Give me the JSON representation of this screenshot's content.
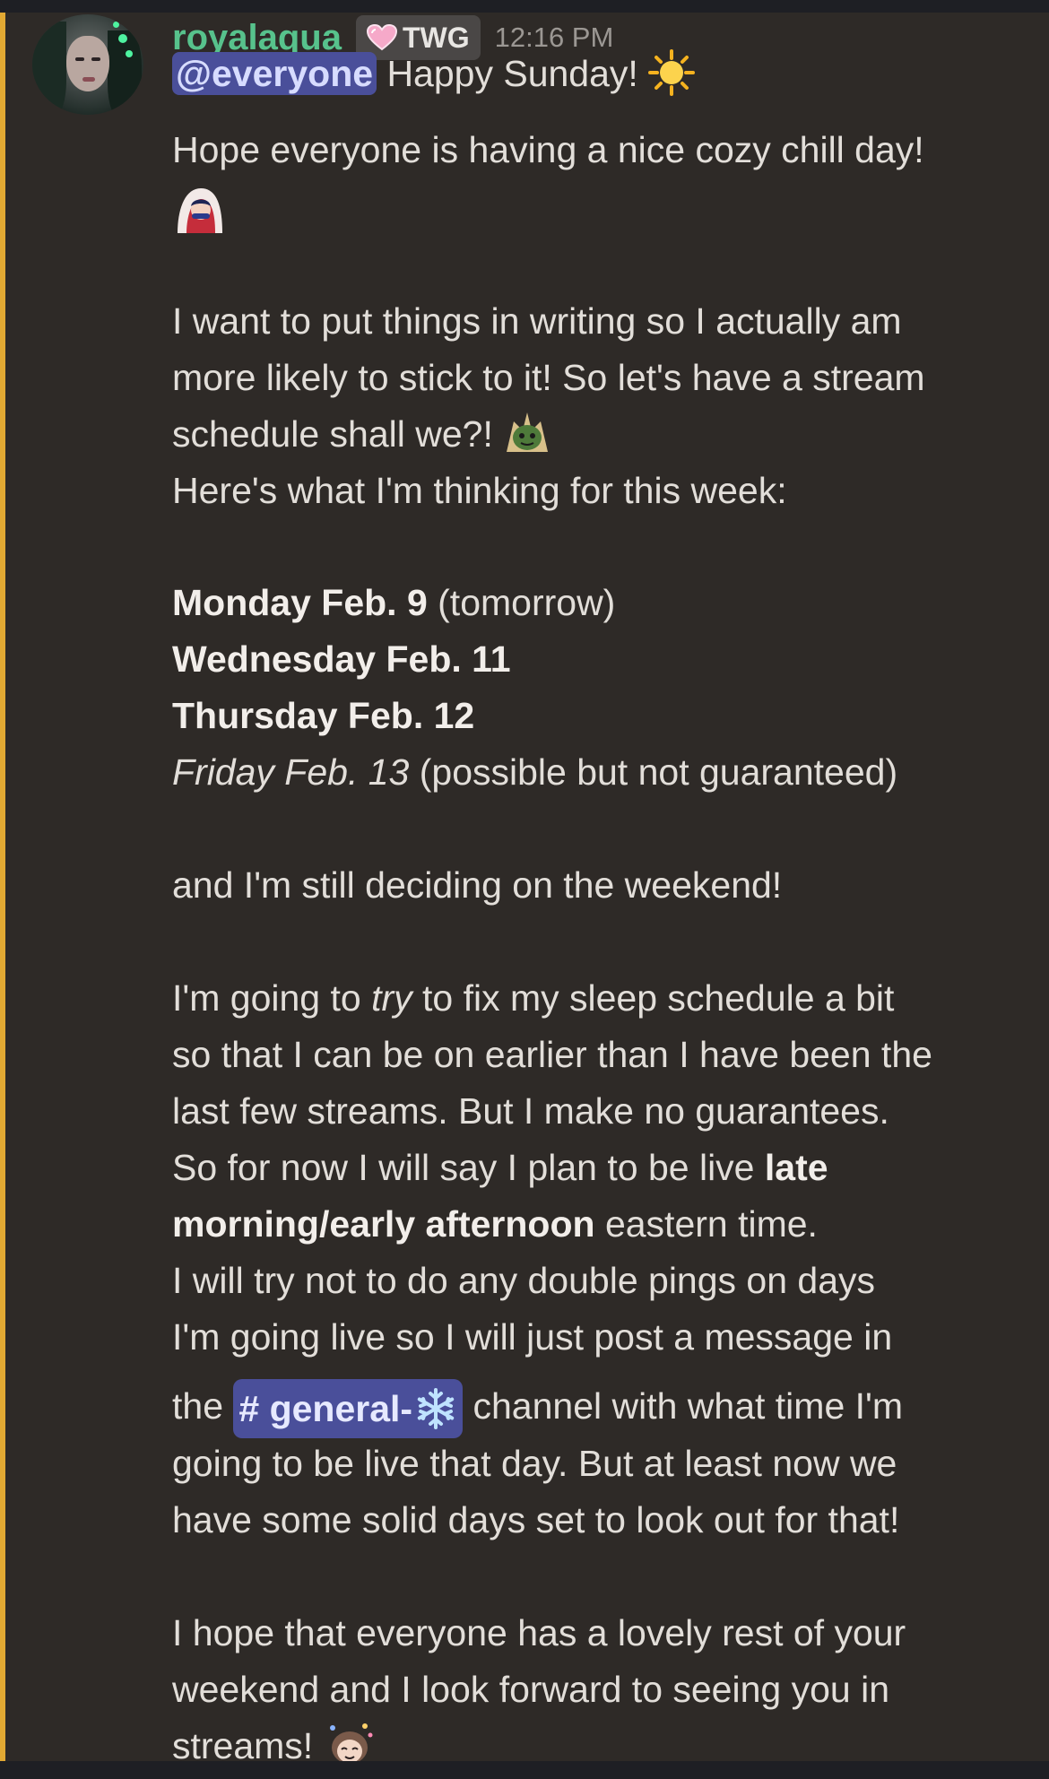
{
  "message": {
    "author": {
      "username": "royalaqua",
      "role_tag": "TWG",
      "timestamp": "12:16 PM"
    },
    "lines": {
      "l1_mention": "@everyone",
      "l1_rest": " Happy Sunday! ",
      "l2": "Hope everyone is having a nice cozy chill day!",
      "l3": "I want to put things in writing so I actually am",
      "l4": "more likely to stick to it! So let's have a stream",
      "l5": "schedule shall we?! ",
      "l6": "Here's what I'm thinking for this week:",
      "l7_bold": "Monday Feb. 9",
      "l7_rest": " (tomorrow)",
      "l8": "Wednesday Feb.  11",
      "l9": "Thursday Feb. 12",
      "l10_italic": "Friday Feb. 13",
      "l10_rest": " (possible but not guaranteed)",
      "l11": "and I'm still deciding on the weekend!",
      "l12_a": "I'm going to ",
      "l12_italic": "try",
      "l12_b": " to fix my sleep schedule a bit",
      "l13": "so that I can be on earlier than I have been the",
      "l14": "last few streams. But I make no guarantees.",
      "l15_a": "So for now I will say I plan to be live ",
      "l15_bold": "late",
      "l16_bold": "morning/early afternoon",
      "l16_rest": " eastern time.",
      "l17": "I will try not to do any double pings on days",
      "l18": "I'm going live so I will just post a message in",
      "l19_a": "the ",
      "l19_channel": "# general-",
      "l19_b": " channel with what time I'm",
      "l20": "going to be live that day. But at least now we",
      "l21": "have some solid days set to look out for that!",
      "l22": "I hope that everyone has a lovely rest of your",
      "l23": "weekend and I look forward to seeing you in",
      "l24": "streams! "
    }
  },
  "icons": [
    "avatar",
    "heart-role-icon",
    "sun-emoji",
    "hooded-character-emoji",
    "goblin-emoji",
    "snowflake-icon",
    "party-character-emoji"
  ],
  "colors": {
    "background": "#2e2a27",
    "mention_stripe": "#e2a933",
    "username": "#57c28c",
    "mention_pill": "#4a4f9a",
    "text": "#e2ded9"
  }
}
